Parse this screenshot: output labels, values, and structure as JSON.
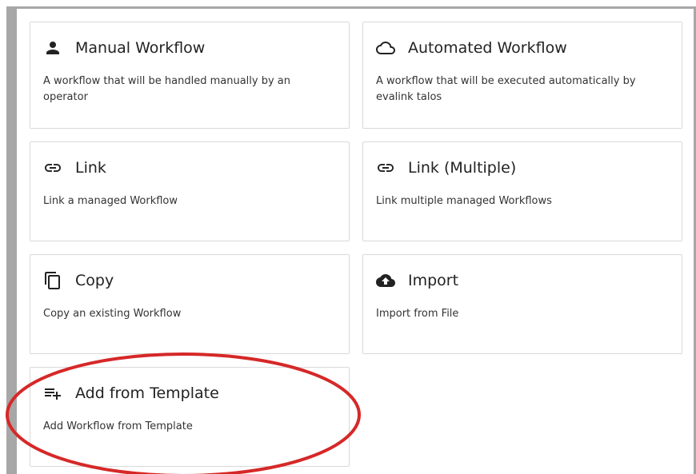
{
  "cards": [
    {
      "title": "Manual Workflow",
      "description": "A workflow that will be handled manually by an operator",
      "icon": "person-icon"
    },
    {
      "title": "Automated Workflow",
      "description": "A workflow that will be executed automatically by evalink talos",
      "icon": "cloud-icon"
    },
    {
      "title": "Link",
      "description": "Link a managed Workflow",
      "icon": "link-icon"
    },
    {
      "title": "Link (Multiple)",
      "description": "Link multiple managed Workflows",
      "icon": "link-icon"
    },
    {
      "title": "Copy",
      "description": "Copy an existing Workflow",
      "icon": "copy-icon"
    },
    {
      "title": "Import",
      "description": "Import from File",
      "icon": "cloud-upload-icon"
    },
    {
      "title": "Add from Template",
      "description": "Add Workflow from Template",
      "icon": "playlist-add-icon"
    }
  ],
  "annotation": {
    "color": "#d62828"
  }
}
